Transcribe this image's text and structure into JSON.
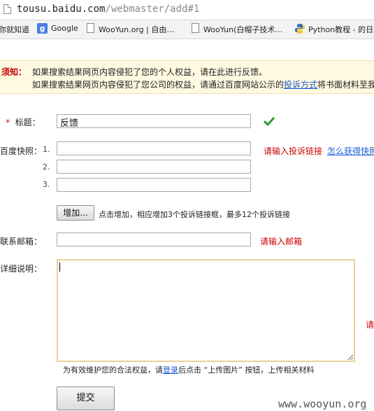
{
  "browser": {
    "url_host": "tousu.baidu.com",
    "url_path": "/webmaster/add#1",
    "bookmarks": [
      {
        "label": "你就知道"
      },
      {
        "icon": "google-icon",
        "icon_text": "g",
        "label": "Google"
      },
      {
        "icon": "page-icon",
        "label": "WooYun.org | 自由…"
      },
      {
        "icon": "page-icon",
        "label": "WooYun(白帽子技术…"
      },
      {
        "icon": "python-icon",
        "label": "Python教程 - 的日"
      }
    ]
  },
  "notice": {
    "label": "须知：",
    "line1": "如果搜索结果网页内容侵犯了您的个人权益，请在此进行反馈。",
    "line2_pre": "如果搜索结果网页内容侵犯了您公司的权益，请通过百度网站公示的",
    "line2_link": "投诉方式",
    "line2_post": "将书面材料至我"
  },
  "form": {
    "title": {
      "required_mark": "*",
      "label": "标题：",
      "value": "反馈",
      "valid_icon": "check-icon"
    },
    "snapshot": {
      "label": "百度快照：",
      "rows": [
        {
          "num": "1."
        },
        {
          "num": "2."
        },
        {
          "num": "3."
        }
      ],
      "error": "请输入投诉链接",
      "help_link": "怎么获得快照"
    },
    "add": {
      "button": "增加...",
      "hint": "点击增加，相应增加3个投诉链接框，最多12个投诉链接"
    },
    "email": {
      "label": "联系邮箱：",
      "value": "",
      "error": "请输入邮箱"
    },
    "detail": {
      "label": "详细说明：",
      "value": "",
      "error": "请"
    },
    "upload": {
      "pre": "为有效维护您的合法权益，请",
      "link": "登录",
      "post": "后点击 “上传图片” 按钮，上传相关材料"
    },
    "submit": "提交"
  },
  "watermark": "www.wooyun.org",
  "colors": {
    "error": "#cc0000",
    "link": "#1a5ad6",
    "notice_bg": "#fef9e0",
    "valid": "#2e9a2e"
  }
}
